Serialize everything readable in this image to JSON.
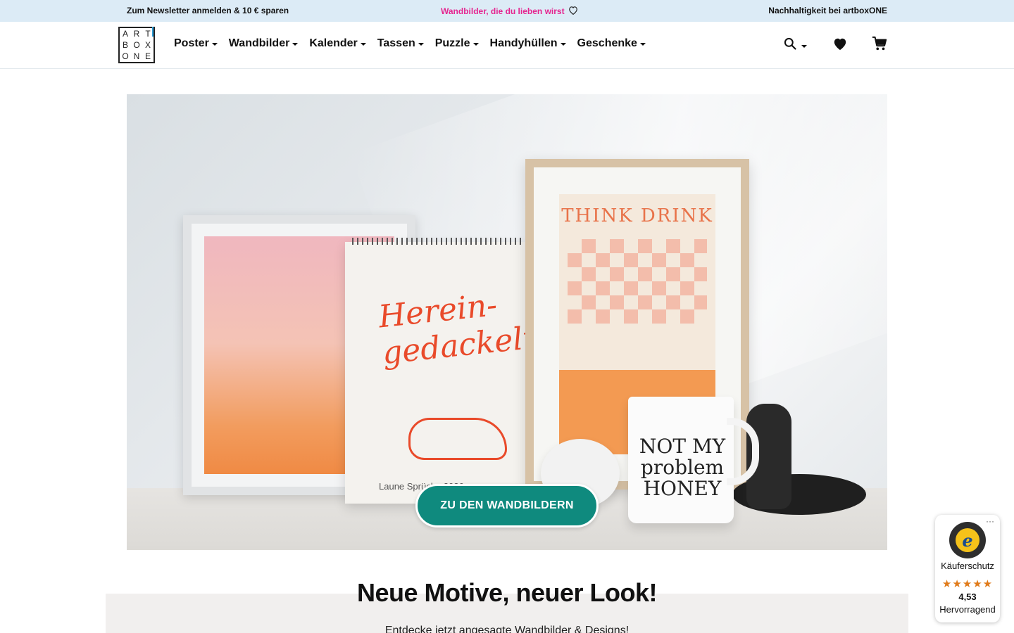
{
  "topbar": {
    "newsletter": "Zum Newsletter anmelden & 10 € sparen",
    "promo": "Wandbilder, die du lieben wirst",
    "sustainability": "Nachhaltigkeit bei artboxONE",
    "promo_color": "#e5258f",
    "background": "#dcebf6"
  },
  "logo": {
    "letters": [
      "A",
      "R",
      "T",
      "B",
      "O",
      "X",
      "O",
      "N",
      "E"
    ],
    "accent_color": "#2e9fd8"
  },
  "nav": {
    "items": [
      {
        "label": "Poster"
      },
      {
        "label": "Wandbilder"
      },
      {
        "label": "Kalender"
      },
      {
        "label": "Tassen"
      },
      {
        "label": "Puzzle"
      },
      {
        "label": "Handyhüllen"
      },
      {
        "label": "Geschenke"
      }
    ]
  },
  "tools": {
    "search_icon": "search-icon",
    "wishlist_icon": "heart-icon",
    "cart_icon": "cart-icon"
  },
  "hero": {
    "calendar_script": "Herein-\ngedackelt",
    "calendar_caption": "Laune Sprüche 2026",
    "poster_title": "THINK DRINK",
    "mug_text": "NOT MY\nproblem\nHONEY",
    "cta_label": "ZU DEN WANDBILDERN",
    "cta_color": "#0f8a7e"
  },
  "section": {
    "title": "Neue Motive, neuer Look!",
    "subtitle": "Entdecke jetzt angesagte Wandbilder & Designs!"
  },
  "trust_badge": {
    "seal_letter": "e",
    "label": "Käuferschutz",
    "stars": "★★★★★",
    "score": "4,53",
    "grade": "Hervorragend",
    "more": "···",
    "star_color": "#e07b1a"
  }
}
